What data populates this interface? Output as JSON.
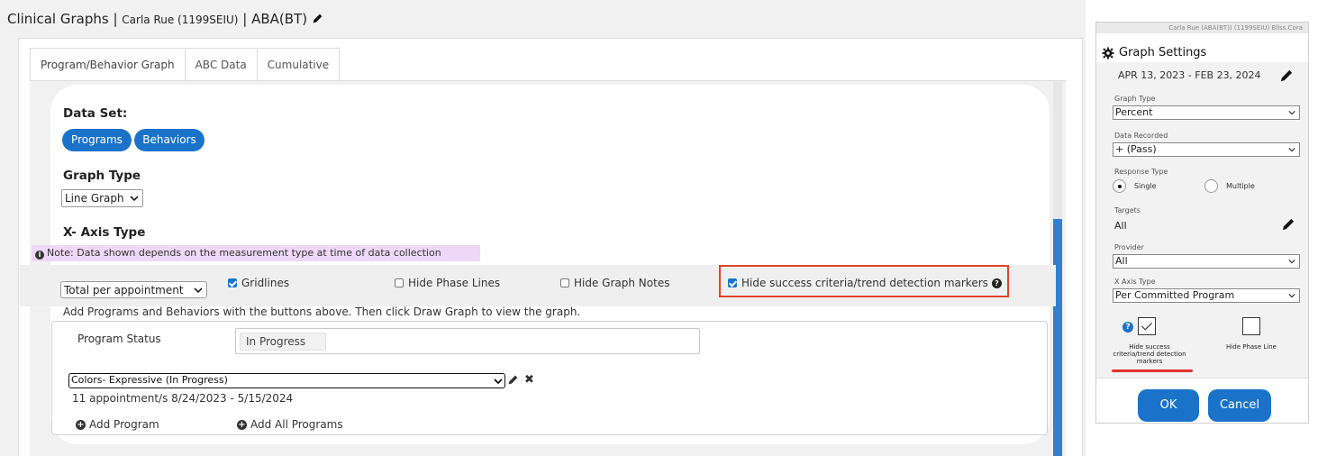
{
  "header": {
    "title": "Clinical Graphs",
    "separator": " | ",
    "client": "Carla Rue (1199SEIU)",
    "service": "| ABA(BT)"
  },
  "tabs": [
    "Program/Behavior Graph",
    "ABC Data",
    "Cumulative"
  ],
  "data_set": {
    "heading": "Data Set:",
    "buttons": [
      "Programs",
      "Behaviors"
    ]
  },
  "graph_type": {
    "heading": "Graph Type",
    "value": "Line Graph"
  },
  "x_axis": {
    "heading": "X- Axis Type",
    "note": "Note: Data shown depends on the measurement type at time of data collection",
    "select_value": "Total per appointment"
  },
  "options": {
    "gridlines": {
      "label": "Gridlines",
      "checked": true
    },
    "hide_phase_lines": {
      "label": "Hide Phase Lines",
      "checked": false
    },
    "hide_graph_notes": {
      "label": "Hide Graph Notes",
      "checked": false
    },
    "hide_success_criteria": {
      "label": "Hide success criteria/trend detection markers",
      "checked": true
    }
  },
  "instructions": "Add Programs and Behaviors with the buttons above. Then click Draw Graph to view the graph.",
  "program_panel": {
    "status_label": "Program Status",
    "status_tag": "In Progress",
    "program_select": "Colors- Expressive (In Progress)",
    "appointments": "11 appointment/s 8/24/2023 - 5/15/2024",
    "add_program": "Add Program",
    "add_all_programs": "Add All Programs"
  },
  "graph_settings": {
    "top_strip": "Carla Rue (ABA(BT)) (1199SEIU)   Bliss.Cora",
    "title": "Graph Settings",
    "date_range": "APR 13, 2023 - FEB 23, 2024",
    "graph_type_label": "Graph Type",
    "graph_type_value": "Percent",
    "data_recorded_label": "Data Recorded",
    "data_recorded_value": "+ (Pass)",
    "response_type_label": "Response Type",
    "response_single": "Single",
    "response_multiple": "Multiple",
    "response_selected": "Single",
    "targets_label": "Targets",
    "targets_value": "All",
    "provider_label": "Provider",
    "provider_value": "All",
    "x_axis_label": "X Axis Type",
    "x_axis_value": "Per Committed Program",
    "hide_success_label": "Hide success criteria/trend detection markers",
    "hide_success_checked": true,
    "hide_phase_label": "Hide Phase Line",
    "hide_phase_checked": false,
    "ok_label": "OK",
    "cancel_label": "Cancel"
  },
  "colors": {
    "primary_blue": "#1a73c9",
    "highlight_red": "#e2452a",
    "note_bg": "#efd8f7"
  }
}
